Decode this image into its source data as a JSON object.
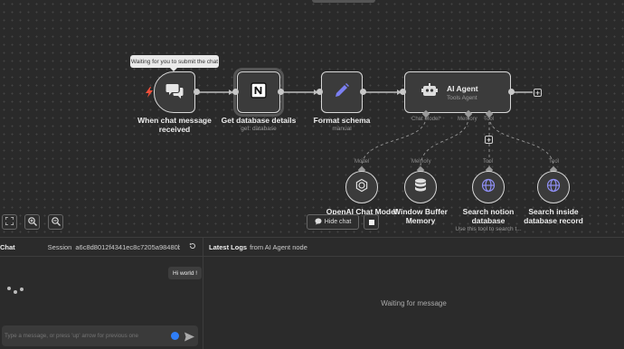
{
  "tooltip": "Waiting for you to submit the chat",
  "nodes": {
    "trigger": {
      "title_line1": "When chat message",
      "title_line2": "received"
    },
    "notion": {
      "title": "Get database details",
      "subtitle": "get: database"
    },
    "format": {
      "title": "Format schema",
      "subtitle": "manual"
    },
    "agent": {
      "title": "AI Agent",
      "subtitle": "Tools Agent",
      "port_chat_model": "Chat Model*",
      "port_memory": "Memory",
      "port_tool": "Tool"
    },
    "openai": {
      "title": "OpenAI Chat Model",
      "port": "Model"
    },
    "memory": {
      "title_line1": "Window Buffer",
      "title_line2": "Memory",
      "port": "Memory"
    },
    "search1": {
      "title_line1": "Search notion",
      "title_line2": "database",
      "note": "Use this tool to search t...",
      "port": "Tool"
    },
    "search2": {
      "title_line1": "Search inside",
      "title_line2": "database record",
      "port": "Tool"
    }
  },
  "canvas_controls": {
    "hide_chat": "Hide chat"
  },
  "chat": {
    "title": "Chat",
    "session_label": "Session",
    "session_id": "a6c8d8012f4341ec8c7205a98480be...",
    "message": "Hi world !",
    "input_placeholder": "Type a message, or press 'up' arrow for previous one"
  },
  "logs": {
    "title": "Latest Logs",
    "from_text": "from AI Agent node",
    "waiting": "Waiting for message"
  },
  "colors": {
    "accent_blue": "#2f7ef7",
    "trigger_bolt": "#f04f3a",
    "pen_purple": "#7b7ff2",
    "tool_icon": "#8f8ff5"
  },
  "icons": [
    "chat-bubbles-icon",
    "notion-icon",
    "pen-icon",
    "robot-icon",
    "openai-icon",
    "database-icon",
    "globe-icon",
    "zoom-fit-icon",
    "zoom-in-icon",
    "zoom-out-icon",
    "stop-icon",
    "reset-icon",
    "send-icon"
  ]
}
